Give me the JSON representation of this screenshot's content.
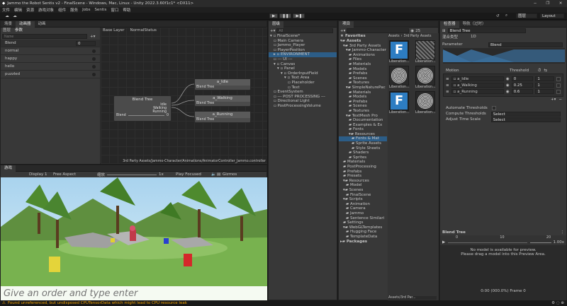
{
  "window": {
    "title": "Jammo the Robot Sentis v2 - FinalScene - Windows, Mac, Linux - Unity 2022.3.60f1c1* <DX11>"
  },
  "menu": [
    "文件",
    "编辑",
    "资源",
    "游戏对象",
    "组件",
    "服务",
    "Jobs",
    "Sentis",
    "窗口",
    "帮助"
  ],
  "toolbar": {
    "layers": "图层",
    "layout": "Layout"
  },
  "animator": {
    "tabs": [
      "场景",
      "动画器",
      "动画"
    ],
    "sub_tabs": [
      "图层",
      "参数"
    ],
    "search_placeholder": "Name",
    "params": [
      {
        "name": "Blend",
        "value": "0"
      },
      {
        "name": "normal"
      },
      {
        "name": "happy"
      },
      {
        "name": "hello"
      },
      {
        "name": "puzzled"
      }
    ],
    "breadcrumb": [
      "Base Layer",
      "NormalStatus"
    ],
    "blend_node": {
      "title": "Blend Tree",
      "items": [
        "Idle",
        "Walking",
        "Running"
      ],
      "param": "Blend",
      "value": "0"
    },
    "motions": [
      {
        "name": "a_Idle",
        "sub": "Blend Tree"
      },
      {
        "name": "a_Walking",
        "sub": "Blend Tree"
      },
      {
        "name": "a_Running",
        "sub": "Blend Tree"
      }
    ],
    "status": "3rd Party Assets/Jammo-Character/Animations/AnimatorController_Jammo.controller"
  },
  "game": {
    "tab": "游戏",
    "display": "Display 1",
    "aspect": "Free Aspect",
    "scale_label": "缩放",
    "scale": "1x",
    "play_mode": "Play Focused",
    "gizmos": "Gizmos",
    "input_placeholder": "Give an order and type enter"
  },
  "hierarchy": {
    "tab": "层级",
    "search_placeholder": "All",
    "items": [
      {
        "t": "FinalScene*",
        "d": 0,
        "arrow": "▾"
      },
      {
        "t": "Main Camera",
        "d": 1
      },
      {
        "t": "Jammo_Player",
        "d": 1
      },
      {
        "t": "PlayerPosition",
        "d": 1
      },
      {
        "t": "ENVIRONMENT",
        "d": 1,
        "arrow": "▸",
        "sel": true
      },
      {
        "t": "--- UI ---",
        "d": 1
      },
      {
        "t": "Canvas",
        "d": 1,
        "arrow": "▾"
      },
      {
        "t": "Panel",
        "d": 2,
        "arrow": "▾"
      },
      {
        "t": "OrderInputField",
        "d": 3,
        "arrow": "▾"
      },
      {
        "t": "Text Area",
        "d": 4,
        "arrow": "▾"
      },
      {
        "t": "Placeholder",
        "d": 5
      },
      {
        "t": "Text",
        "d": 5
      },
      {
        "t": "EventSystem",
        "d": 1
      },
      {
        "t": "--- POST PROCESSING ---",
        "d": 1
      },
      {
        "t": "Directional Light",
        "d": 1
      },
      {
        "t": "PostProcessingVolume",
        "d": 1
      }
    ]
  },
  "project": {
    "tab": "项目",
    "favorites": "Favorites",
    "count": "25",
    "breadcrumb": [
      "Assets",
      "3rd Party Assets"
    ],
    "tree": [
      {
        "t": "Assets",
        "d": 0,
        "arrow": "▾",
        "bold": true
      },
      {
        "t": "3rd Party Assets",
        "d": 1,
        "arrow": "▾"
      },
      {
        "t": "Jammo-Character",
        "d": 2,
        "arrow": "▾"
      },
      {
        "t": "Animations",
        "d": 3
      },
      {
        "t": "Files",
        "d": 3
      },
      {
        "t": "Materials",
        "d": 3
      },
      {
        "t": "Models",
        "d": 3
      },
      {
        "t": "Prefabs",
        "d": 3
      },
      {
        "t": "Scenes",
        "d": 3
      },
      {
        "t": "Textures",
        "d": 3
      },
      {
        "t": "SimpleNaturePac",
        "d": 2,
        "arrow": "▾"
      },
      {
        "t": "Materials",
        "d": 3
      },
      {
        "t": "Models",
        "d": 3
      },
      {
        "t": "Prefabs",
        "d": 3
      },
      {
        "t": "Scenes",
        "d": 3
      },
      {
        "t": "Textures",
        "d": 3
      },
      {
        "t": "TextMesh Pro",
        "d": 2,
        "arrow": "▾"
      },
      {
        "t": "Documentation",
        "d": 3
      },
      {
        "t": "Examples & Ex",
        "d": 3
      },
      {
        "t": "Fonts",
        "d": 3
      },
      {
        "t": "Resources",
        "d": 3,
        "arrow": "▾"
      },
      {
        "t": "Fonts & Mat",
        "d": 4,
        "sel": true
      },
      {
        "t": "Sprite Assets",
        "d": 4
      },
      {
        "t": "Style Sheets",
        "d": 4
      },
      {
        "t": "Shaders",
        "d": 3
      },
      {
        "t": "Sprites",
        "d": 3
      },
      {
        "t": "Materials",
        "d": 1
      },
      {
        "t": "PostProcessing",
        "d": 1
      },
      {
        "t": "Prefabs",
        "d": 1
      },
      {
        "t": "Presets",
        "d": 1
      },
      {
        "t": "Resources",
        "d": 1,
        "arrow": "▾"
      },
      {
        "t": "Model",
        "d": 2
      },
      {
        "t": "Scenes",
        "d": 1,
        "arrow": "▾"
      },
      {
        "t": "FinalScene",
        "d": 2
      },
      {
        "t": "Scripts",
        "d": 1,
        "arrow": "▾"
      },
      {
        "t": "Animation",
        "d": 2
      },
      {
        "t": "Camera",
        "d": 2
      },
      {
        "t": "Jammo",
        "d": 2
      },
      {
        "t": "Sentence Similari",
        "d": 2
      },
      {
        "t": "Settings",
        "d": 1
      },
      {
        "t": "WebGLTemplates",
        "d": 1,
        "arrow": "▾"
      },
      {
        "t": "Hugging Face",
        "d": 2
      },
      {
        "t": "TemplateData",
        "d": 2
      },
      {
        "t": "Packages",
        "d": 0,
        "arrow": "▸",
        "bold": true
      }
    ],
    "assets": [
      "Liberation...",
      "Liberation...",
      "Liberation...",
      "Liberation...",
      "Liberation...",
      "Liberation..."
    ],
    "footer": "Assets/3rd Par..."
  },
  "inspector": {
    "tabs": [
      "检查器",
      "导航（过时）"
    ],
    "name": "Blend Tree",
    "type_label": "混合类型",
    "type_value": "1D",
    "param_label": "Parameter",
    "param_value": "Blend",
    "motion_header": "Motion",
    "threshold_header": "Threshold",
    "motions": [
      {
        "name": "a_Idle",
        "th": "0",
        "sp": "1"
      },
      {
        "name": "a_Walking",
        "th": "0.25",
        "sp": "1"
      },
      {
        "name": "a_Running",
        "th": "0.6",
        "sp": "1"
      }
    ],
    "auto_label": "Automate Thresholds",
    "compute_label": "Compute Thresholds",
    "compute_value": "Select",
    "adjust_label": "Adjust Time Scale",
    "adjust_value": "Select",
    "preview_title": "Blend Tree",
    "preview_speed": "1.00x",
    "preview_msg1": "No model is available for preview.",
    "preview_msg2": "Please drag a model into this Preview Area.",
    "preview_time": "0:00 (000.0%) Frame 0",
    "preview_nums": [
      "0",
      "10",
      "20"
    ]
  },
  "status_bar": {
    "message": "Found unreferenced, but undisposed CPUTensorData which might lead to CPU resource leak"
  },
  "colors": {
    "accent": "#2c5d87",
    "warning": "#f0a000",
    "sky": "#8fc4e6",
    "grass": "#6ba04a"
  }
}
